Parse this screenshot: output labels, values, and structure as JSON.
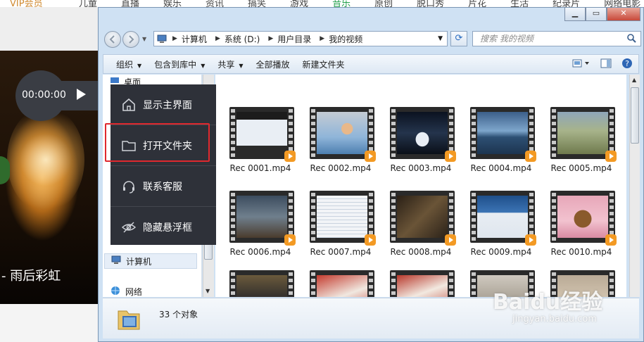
{
  "background_page": {
    "vip_label": "VIP会员",
    "nav_items": [
      "儿童",
      "直播",
      "娱乐",
      "资讯",
      "搞笑",
      "游戏",
      "音乐",
      "原创",
      "脱口秀",
      "片花",
      "生活",
      "纪录片",
      "网络电影"
    ],
    "active_nav": "音乐",
    "video_title": "- 雨后彩虹"
  },
  "player": {
    "time": "00:00:00",
    "play_icon": "play-icon",
    "stop_icon": "stop-icon"
  },
  "float_menu": {
    "items": [
      {
        "label": "显示主界面",
        "icon": "home-icon"
      },
      {
        "label": "打开文件夹",
        "icon": "folder-icon"
      },
      {
        "label": "联系客服",
        "icon": "headset-icon"
      },
      {
        "label": "隐藏悬浮框",
        "icon": "eye-hidden-icon"
      }
    ],
    "highlight_color": "#e0282e"
  },
  "explorer": {
    "address": {
      "segments": [
        "计算机",
        "系统 (D:)",
        "用户目录",
        "我的视频"
      ]
    },
    "search_placeholder": "搜索 我的视频",
    "toolbar": {
      "organize": "组织",
      "include_library": "包含到库中",
      "share": "共享",
      "play_all": "全部播放",
      "new_folder": "新建文件夹"
    },
    "nav": {
      "desktop": "桌面",
      "computer": "计算机",
      "network": "网络"
    },
    "files": [
      {
        "name": "Rec 0001.mp4"
      },
      {
        "name": "Rec 0002.mp4"
      },
      {
        "name": "Rec 0003.mp4"
      },
      {
        "name": "Rec 0004.mp4"
      },
      {
        "name": "Rec 0005.mp4"
      },
      {
        "name": "Rec 0006.mp4"
      },
      {
        "name": "Rec 0007.mp4"
      },
      {
        "name": "Rec 0008.mp4"
      },
      {
        "name": "Rec 0009.mp4"
      },
      {
        "name": "Rec 0010.mp4"
      }
    ],
    "status": {
      "count": "33 个对象"
    }
  },
  "watermark": {
    "brand": "Baidu经验",
    "url": "jingyan.baidu.com"
  }
}
